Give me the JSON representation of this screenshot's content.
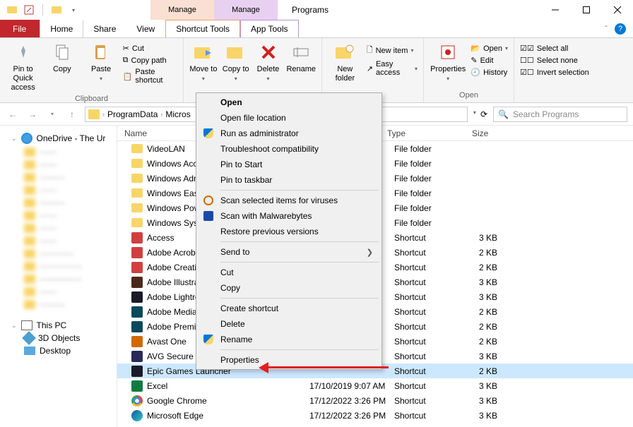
{
  "window": {
    "title": "Programs"
  },
  "context_tabs": [
    {
      "label": "Manage",
      "sub": "Shortcut Tools"
    },
    {
      "label": "Manage",
      "sub": "App Tools"
    }
  ],
  "tabs": {
    "file": "File",
    "home": "Home",
    "share": "Share",
    "view": "View",
    "tool1": "Shortcut Tools",
    "tool2": "App Tools"
  },
  "ribbon": {
    "clipboard": {
      "label": "Clipboard",
      "pin": "Pin to Quick access",
      "copy": "Copy",
      "paste": "Paste",
      "cut": "Cut",
      "copypath": "Copy path",
      "pasteshortcut": "Paste shortcut"
    },
    "organize": {
      "moveto": "Move to",
      "copyto": "Copy to",
      "delete": "Delete",
      "rename": "Rename"
    },
    "new": {
      "folder": "New folder",
      "item": "New item",
      "easy": "Easy access"
    },
    "open": {
      "label": "Open",
      "properties": "Properties",
      "open": "Open",
      "edit": "Edit",
      "history": "History"
    },
    "select": {
      "all": "Select all",
      "none": "Select none",
      "invert": "Invert selection"
    }
  },
  "address": {
    "segments": [
      "ProgramData",
      "Micros"
    ],
    "search_placeholder": "Search Programs"
  },
  "nav": {
    "onedrive": "OneDrive - The Ur",
    "thispc": "This PC",
    "threed": "3D Objects",
    "desktop": "Desktop"
  },
  "columns": {
    "name": "Name",
    "type": "Type",
    "size": "Size"
  },
  "rows": [
    {
      "name": "VideoLAN",
      "type": "File folder",
      "size": "",
      "ico": "ico-folder"
    },
    {
      "name": "Windows Acc",
      "type": "File folder",
      "size": "",
      "ico": "ico-folder"
    },
    {
      "name": "Windows Adm",
      "type": "File folder",
      "size": "",
      "ico": "ico-folder"
    },
    {
      "name": "Windows Ease",
      "type": "File folder",
      "size": "",
      "ico": "ico-folder"
    },
    {
      "name": "Windows Pow",
      "type": "File folder",
      "size": "",
      "ico": "ico-folder"
    },
    {
      "name": "Windows Syst",
      "type": "File folder",
      "size": "",
      "ico": "ico-folder"
    },
    {
      "name": "Access",
      "type": "Shortcut",
      "size": "3 KB",
      "ico": "ico-app"
    },
    {
      "name": "Adobe Acroba",
      "type": "Shortcut",
      "size": "2 KB",
      "ico": "ico-app"
    },
    {
      "name": "Adobe Creativ",
      "type": "Shortcut",
      "size": "2 KB",
      "ico": "ico-app"
    },
    {
      "name": "Adobe Illustra",
      "type": "Shortcut",
      "size": "3 KB",
      "ico": "ico-app2"
    },
    {
      "name": "Adobe Lightro",
      "type": "Shortcut",
      "size": "3 KB",
      "ico": "ico-app3"
    },
    {
      "name": "Adobe Media",
      "type": "Shortcut",
      "size": "2 KB",
      "ico": "ico-app4"
    },
    {
      "name": "Adobe Premie",
      "type": "Shortcut",
      "size": "2 KB",
      "ico": "ico-app4"
    },
    {
      "name": "Avast One",
      "type": "Shortcut",
      "size": "2 KB",
      "ico": "ico-app5"
    },
    {
      "name": "AVG Secure Br",
      "type": "Shortcut",
      "size": "3 KB",
      "ico": "ico-app6"
    },
    {
      "name": "Epic Games Launcher",
      "date": "",
      "type": "Shortcut",
      "size": "2 KB",
      "ico": "ico-app3",
      "selected": true
    },
    {
      "name": "Excel",
      "date": "17/10/2019 9:07 AM",
      "type": "Shortcut",
      "size": "3 KB",
      "ico": "ico-excel"
    },
    {
      "name": "Google Chrome",
      "date": "17/12/2022 3:26 PM",
      "type": "Shortcut",
      "size": "3 KB",
      "ico": "ico-chrome"
    },
    {
      "name": "Microsoft Edge",
      "date": "17/12/2022 3:26 PM",
      "type": "Shortcut",
      "size": "3 KB",
      "ico": "ico-edge"
    }
  ],
  "context_menu": {
    "open": "Open",
    "openloc": "Open file location",
    "runas": "Run as administrator",
    "trouble": "Troubleshoot compatibility",
    "pinstart": "Pin to Start",
    "pintask": "Pin to taskbar",
    "scanvirus": "Scan selected items for viruses",
    "scanmwb": "Scan with Malwarebytes",
    "restore": "Restore previous versions",
    "sendto": "Send to",
    "cut": "Cut",
    "copy": "Copy",
    "createsc": "Create shortcut",
    "delete": "Delete",
    "rename": "Rename",
    "properties": "Properties"
  }
}
